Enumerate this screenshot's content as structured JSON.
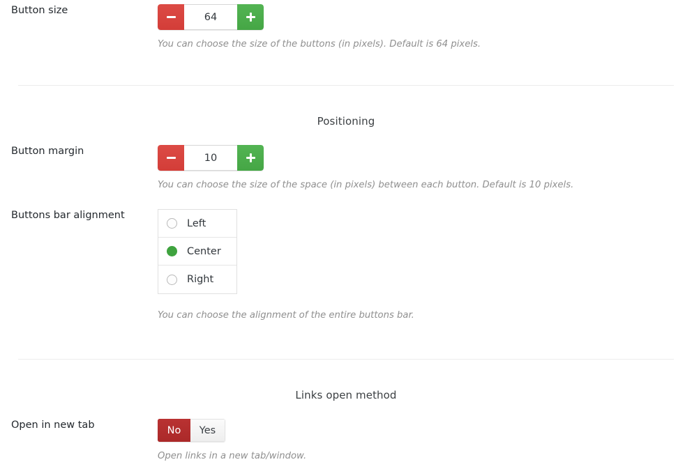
{
  "rows": {
    "button_size": {
      "label": "Button size",
      "value": "64",
      "help": "You can choose the size of the buttons (in pixels). Default is 64 pixels.",
      "decrement_label": "minus",
      "increment_label": "plus"
    },
    "button_margin": {
      "label": "Button margin",
      "value": "10",
      "help": "You can choose the size of the space (in pixels) between each button. Default is 10 pixels.",
      "decrement_label": "minus",
      "increment_label": "plus"
    },
    "buttons_bar_alignment": {
      "label": "Buttons bar alignment",
      "help": "You can choose the alignment of the entire buttons bar.",
      "selected": "Center",
      "options": [
        {
          "label": "Left",
          "selected": false
        },
        {
          "label": "Center",
          "selected": true
        },
        {
          "label": "Right",
          "selected": false
        }
      ]
    },
    "open_in_new_tab": {
      "label": "Open in new tab",
      "help": "Open links in a new tab/window.",
      "selected": "No",
      "options": [
        {
          "label": "No",
          "active": true
        },
        {
          "label": "Yes",
          "active": false
        }
      ]
    }
  },
  "sections": {
    "positioning": "Positioning",
    "links_open_method": "Links open method"
  },
  "colors": {
    "decrement_red": "#d9443f",
    "increment_green": "#4cae4c",
    "radio_selected_green": "#3fa33f",
    "toggle_active_red": "#b32d2d",
    "help_text_gray": "#8f8f8f",
    "divider_gray": "#ececec"
  }
}
